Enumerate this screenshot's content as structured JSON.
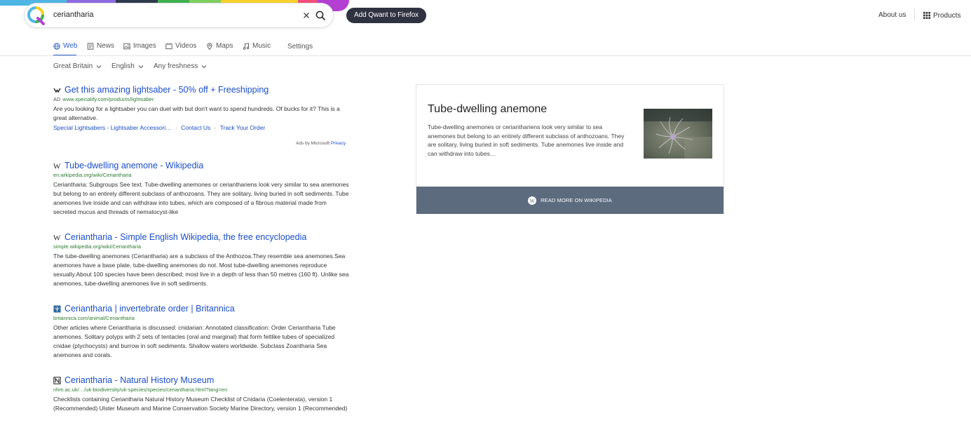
{
  "search": {
    "query": "ceriantharia"
  },
  "header": {
    "firefox_button": "Add Qwant to Firefox",
    "about": "About us",
    "products": "Products"
  },
  "tabs": [
    {
      "label": "Web",
      "icon": "globe-icon",
      "active": true
    },
    {
      "label": "News",
      "icon": "newspaper-icon",
      "active": false
    },
    {
      "label": "Images",
      "icon": "image-icon",
      "active": false
    },
    {
      "label": "Videos",
      "icon": "video-icon",
      "active": false
    },
    {
      "label": "Maps",
      "icon": "map-pin-icon",
      "active": false
    },
    {
      "label": "Music",
      "icon": "music-note-icon",
      "active": false
    },
    {
      "label": "Settings",
      "icon": "",
      "active": false
    }
  ],
  "filters": {
    "region": "Great Britain",
    "language": "English",
    "freshness": "Any freshness"
  },
  "ad": {
    "title": "Get this amazing lightsaber - 50% off + Freeshipping",
    "badge": "AD",
    "url": "www.xpecialify.com/products/lightsaber",
    "description": "Are you looking for a lightsaber you can duel with but don't want to spend hundreds. Of bucks for it? This is a great alternative.",
    "links": [
      "Special Lightsabers - Lightsaber Accessori…",
      "Contact Us",
      "Track Your Order"
    ],
    "ads_by": "Ads by Microsoft",
    "privacy": "Privacy"
  },
  "results": [
    {
      "title": "Tube-dwelling anemone - Wikipedia",
      "favicon": "wikipedia-icon",
      "url": "en.wikipedia.org/wiki/Ceriantharia",
      "description": "Ceriantharia: Subgroups See text. Tube-dwelling anemones or cerianthariens look very similar to sea anemones but belong to an entirely different subclass of anthozoans. They are solitary, living buried in soft sediments. Tube anemones live inside and can withdraw into tubes, which are composed of a fibrous material made from secreted mucus and threads of nematocyst-like"
    },
    {
      "title": "Ceriantharia - Simple English Wikipedia, the free encyclopedia",
      "favicon": "wikipedia-icon",
      "url": "simple.wikipedia.org/wiki/Ceriantharia",
      "description": "The tube-dwelling anemones (Ceriantharia) are a subclass of the Anthozoa.They resemble sea anemones.Sea anemones have a base plate, tube-dwelling anemones do not. Most tube-dwelling anemones reproduce sexually.About 100 species have been described; most live in a depth of less than 50 metres (160 ft). Unlike sea anemones, tube-dwelling anemones live in soft sediments."
    },
    {
      "title": "Ceriantharia | invertebrate order | Britannica",
      "favicon": "britannica-icon",
      "url": "britannica.com/animal/Ceriantharia",
      "description": "Other articles where Ceriantharia is discussed: cnidarian: Annotated classification: Order Ceriantharia Tube anemones. Solitary polyps with 2 sets of tentacles (oral and marginal) that form feltlike tubes of specialized cnidae (ptychocysts) and burrow in soft sediments. Shallow waters worldwide. Subclass Zoantharia Sea anemones and corals."
    },
    {
      "title": "Ceriantharia - Natural History Museum",
      "favicon": "nhm-icon",
      "url": "nhm.ac.uk/…/uk-biodiversity/uk-species/species/ceriantharia.html?lang=en",
      "description": "Checklists containing Ceriantharia Natural History Museum Checklist of Cnidaria (Coelenterata), version 1 (Recommended) Ulster Museum and Marine Conservation Society Marine Directory, version 1 (Recommended)"
    }
  ],
  "knowledge_panel": {
    "title": "Tube-dwelling anemone",
    "description": "Tube-dwelling anemones or cerianthariens look very similar to sea anemones but belong to an entirely different subclass of anthozoans. They are solitary, living buried in soft sediments. Tube anemones live inside and can withdraw into tubes…",
    "read_more": "READ MORE ON WIKIPEDIA"
  },
  "colors": {
    "accent": "#2d5fcb",
    "link": "#1a4ec8",
    "url_green": "#2e7d32",
    "panel_footer": "#5d6b7f",
    "firefox_button": "#2f3240"
  }
}
